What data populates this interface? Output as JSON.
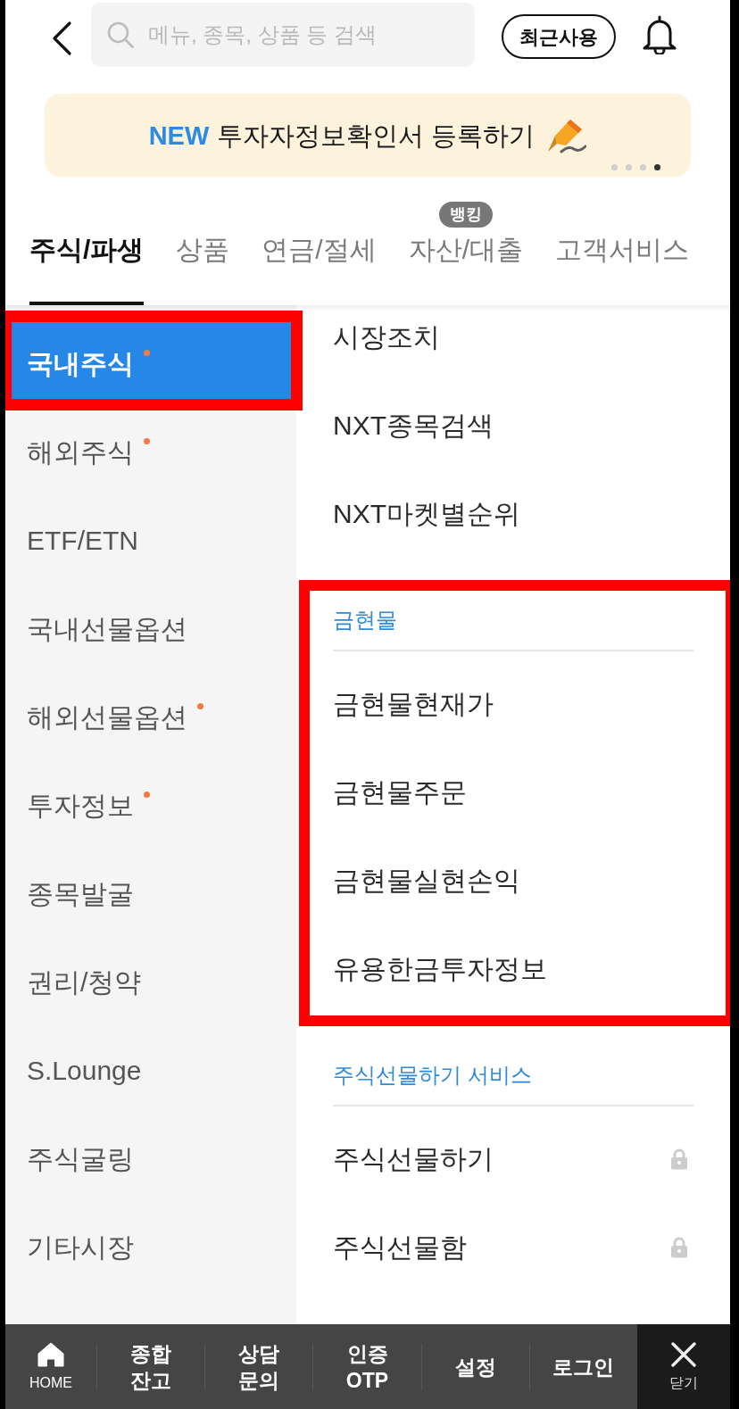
{
  "header": {
    "search": {
      "placeholder": "메뉴, 종목, 상품 등 검색"
    },
    "recent_button": "최근사용"
  },
  "banner": {
    "badge": "NEW",
    "text": "투자자정보확인서 등록하기",
    "pages": [
      {
        "selected": false
      },
      {
        "selected": false
      },
      {
        "selected": false
      },
      {
        "selected": true
      }
    ]
  },
  "tabs": [
    {
      "label": "주식/파생",
      "selected": true
    },
    {
      "label": "상품",
      "selected": false
    },
    {
      "label": "연금/절세",
      "selected": false
    },
    {
      "label": "자산/대출",
      "selected": false,
      "badge": "뱅킹"
    },
    {
      "label": "고객서비스",
      "selected": false
    }
  ],
  "sidebar": {
    "items": [
      {
        "label": "국내주식",
        "selected": true,
        "dot": true,
        "highlighted": true
      },
      {
        "label": "해외주식",
        "selected": false,
        "dot": true,
        "highlighted": false
      },
      {
        "label": "ETF/ETN",
        "selected": false,
        "dot": false,
        "highlighted": false
      },
      {
        "label": "국내선물옵션",
        "selected": false,
        "dot": false,
        "highlighted": false
      },
      {
        "label": "해외선물옵션",
        "selected": false,
        "dot": true,
        "highlighted": false
      },
      {
        "label": "투자정보",
        "selected": false,
        "dot": true,
        "highlighted": false
      },
      {
        "label": "종목발굴",
        "selected": false,
        "dot": false,
        "highlighted": false
      },
      {
        "label": "권리/청약",
        "selected": false,
        "dot": false,
        "highlighted": false
      },
      {
        "label": "S.Lounge",
        "selected": false,
        "dot": false,
        "highlighted": false
      },
      {
        "label": "주식굴링",
        "selected": false,
        "dot": false,
        "highlighted": false
      },
      {
        "label": "기타시장",
        "selected": false,
        "dot": false,
        "highlighted": false
      }
    ]
  },
  "menu": {
    "groups": [
      {
        "highlighted": false,
        "items": [
          {
            "label": "시장조치",
            "locked": false
          },
          {
            "label": "NXT종목검색",
            "locked": false
          },
          {
            "label": "NXT마켓별순위",
            "locked": false
          }
        ]
      },
      {
        "title": "금현물",
        "highlighted": true,
        "items": [
          {
            "label": "금현물현재가",
            "locked": false
          },
          {
            "label": "금현물주문",
            "locked": false
          },
          {
            "label": "금현물실현손익",
            "locked": false
          },
          {
            "label": "유용한금투자정보",
            "locked": false
          }
        ]
      },
      {
        "title": "주식선물하기 서비스",
        "highlighted": false,
        "items": [
          {
            "label": "주식선물하기",
            "locked": true
          },
          {
            "label": "주식선물함",
            "locked": true
          }
        ]
      }
    ]
  },
  "bottom_bar": {
    "items": [
      {
        "kind": "home",
        "lines": [
          "HOME"
        ]
      },
      {
        "kind": "text",
        "lines": [
          "종합",
          "잔고"
        ]
      },
      {
        "kind": "text",
        "lines": [
          "상담",
          "문의"
        ]
      },
      {
        "kind": "text",
        "lines": [
          "인증",
          "OTP"
        ]
      },
      {
        "kind": "text",
        "lines": [
          "설정"
        ]
      },
      {
        "kind": "text",
        "lines": [
          "로그인"
        ]
      },
      {
        "kind": "close",
        "lines": [
          "닫기"
        ]
      }
    ]
  }
}
